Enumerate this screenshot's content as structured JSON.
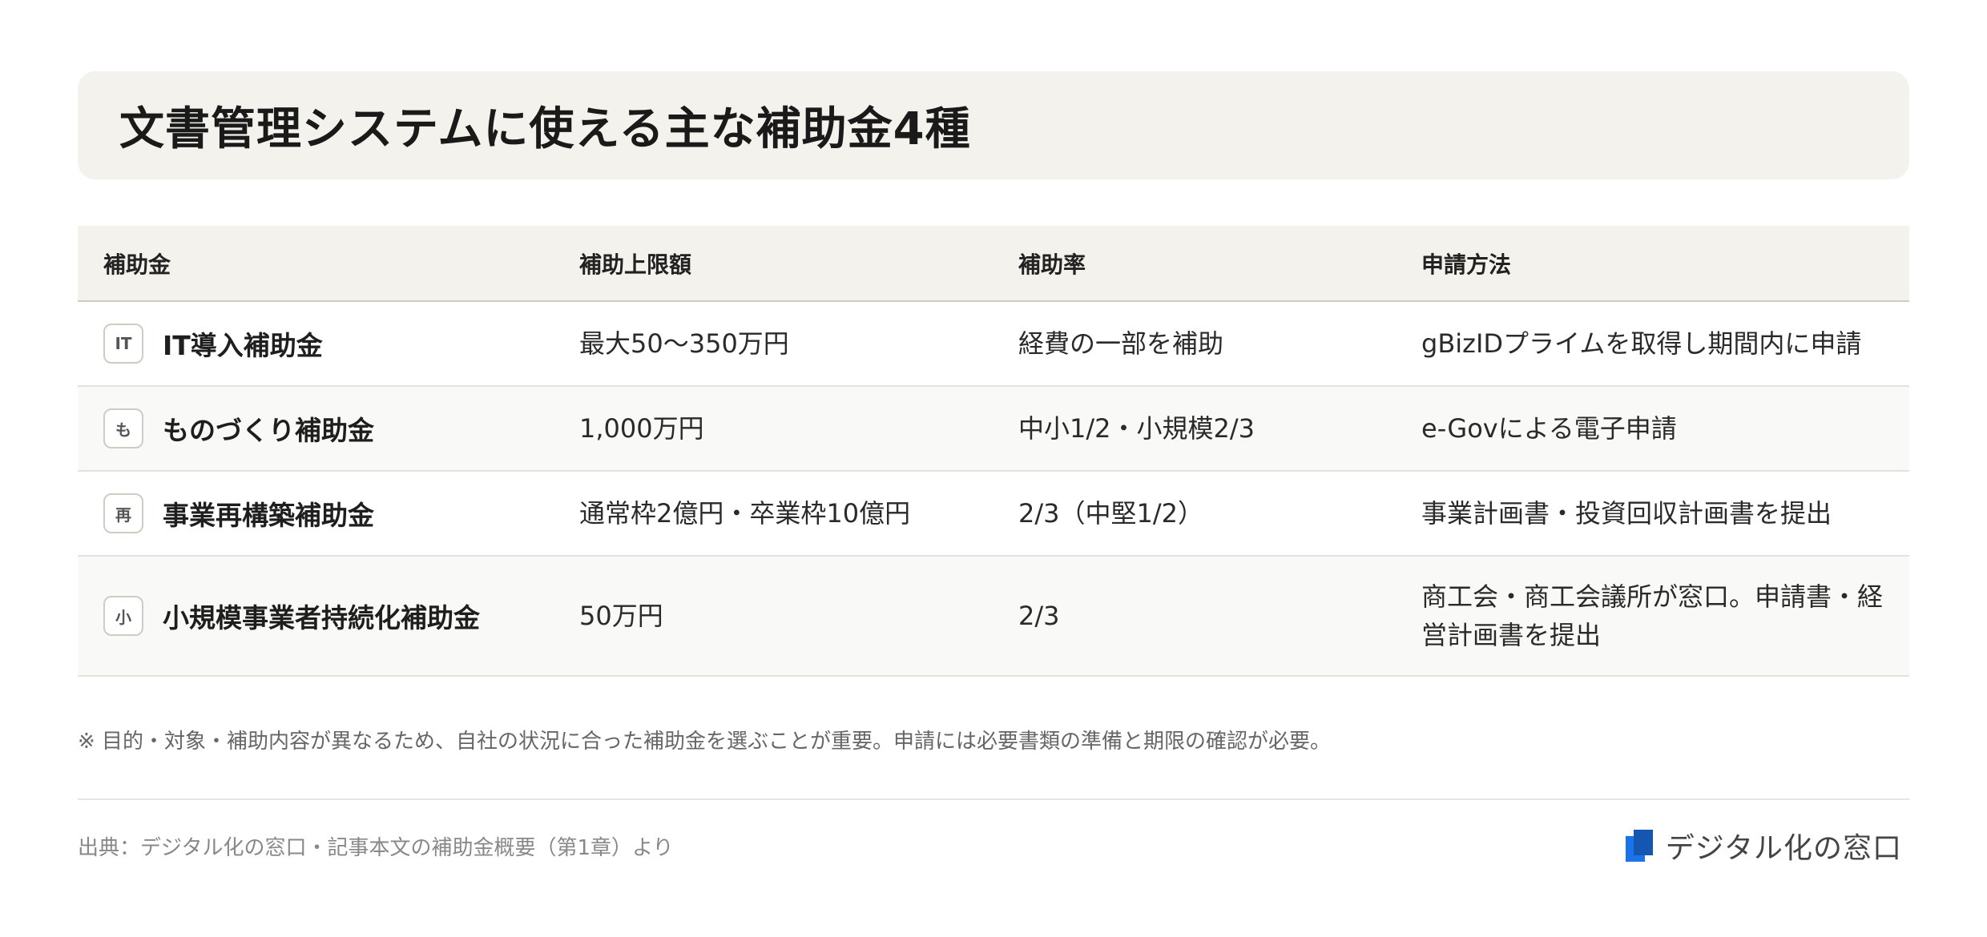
{
  "title": "文書管理システムに使える主な補助金4種",
  "table": {
    "headers": [
      "補助金",
      "補助上限額",
      "補助率",
      "申請方法"
    ],
    "rows": [
      {
        "badge": "IT",
        "name": "IT導入補助金",
        "limit": "最大50〜350万円",
        "rate": "経費の一部を補助",
        "method": "gBizIDプライムを取得し期間内に申請"
      },
      {
        "badge": "も",
        "name": "ものづくり補助金",
        "limit": "1,000万円",
        "rate": "中小1/2・小規模2/3",
        "method": "e-Govによる電子申請"
      },
      {
        "badge": "再",
        "name": "事業再構築補助金",
        "limit": "通常枠2億円・卒業枠10億円",
        "rate": "2/3（中堅1/2）",
        "method": "事業計画書・投資回収計画書を提出"
      },
      {
        "badge": "小",
        "name": "小規模事業者持続化補助金",
        "limit": "50万円",
        "rate": "2/3",
        "method": "商工会・商工会議所が窓口。申請書・経営計画書を提出"
      }
    ]
  },
  "note": "※ 目的・対象・補助内容が異なるため、自社の状況に合った補助金を選ぶことが重要。申請には必要書類の準備と期限の確認が必要。",
  "source": "出典：デジタル化の窓口・記事本文の補助金概要（第1章）より",
  "logo": {
    "text": "デジタル化の窓口",
    "icon": "document-logo-icon"
  },
  "colors": {
    "header_bg": "#f4f2ec",
    "logo_blue": "#1a73e8",
    "logo_dark_blue": "#1557b0"
  }
}
